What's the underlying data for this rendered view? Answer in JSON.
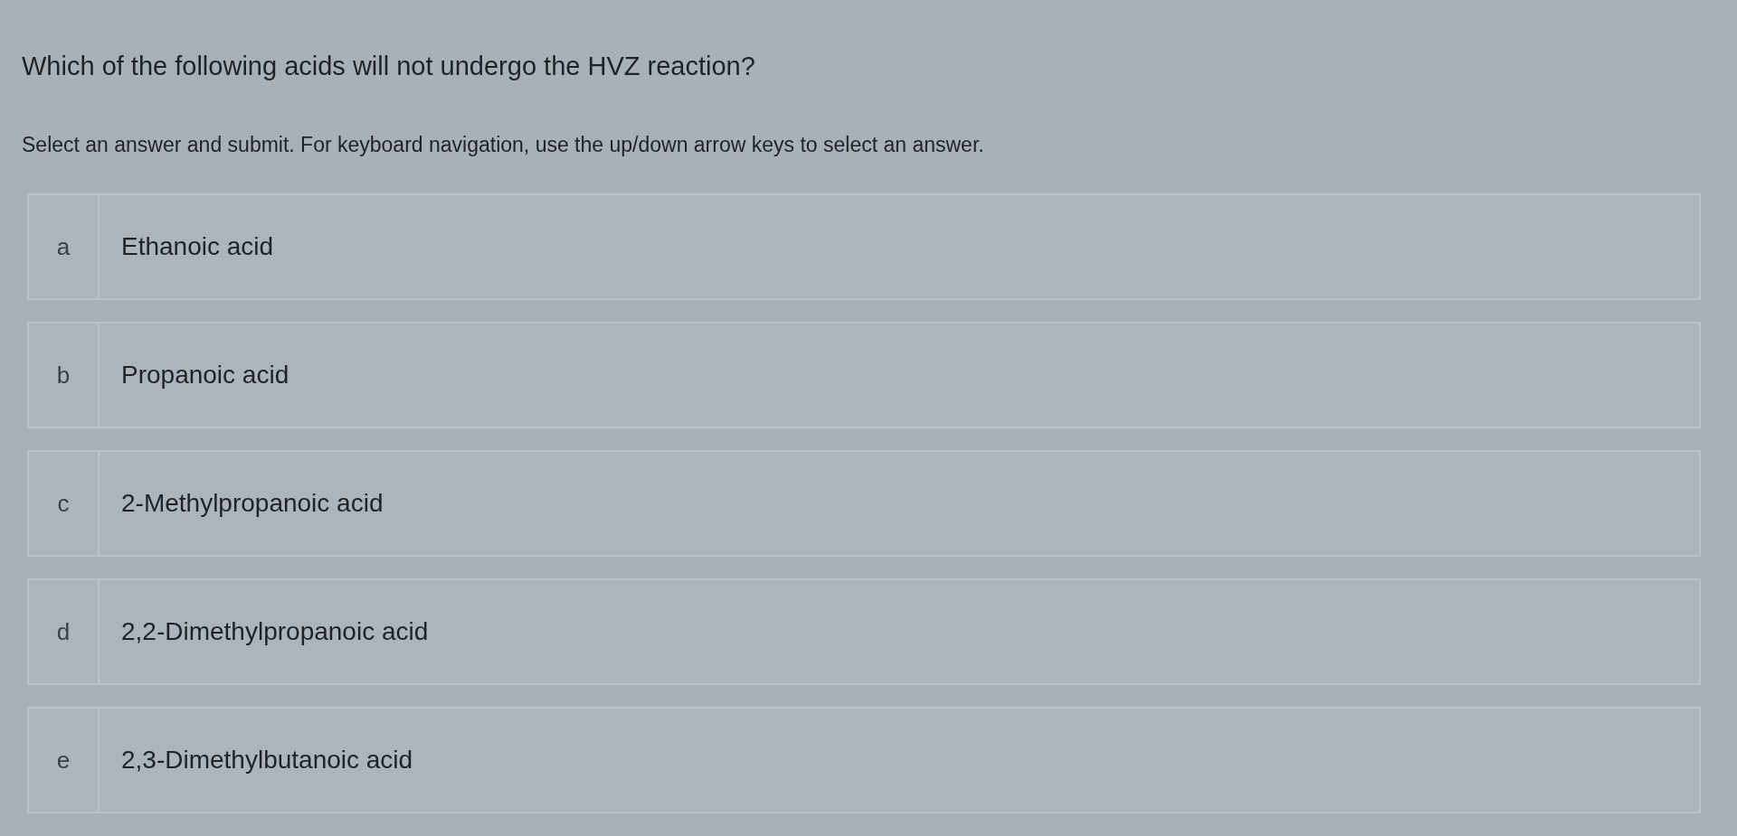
{
  "question": "Which of the following acids will not undergo the HVZ reaction?",
  "instructions": "Select an answer and submit. For keyboard navigation, use the up/down arrow keys to select an answer.",
  "options": [
    {
      "letter": "a",
      "label": "Ethanoic acid",
      "selected": false
    },
    {
      "letter": "b",
      "label": "Propanoic acid",
      "selected": false
    },
    {
      "letter": "c",
      "label": "2-Methylpropanoic acid",
      "selected": false
    },
    {
      "letter": "d",
      "label": "2,2-Dimethylpropanoic acid",
      "selected": false
    },
    {
      "letter": "e",
      "label": "2,3-Dimethylbutanoic acid",
      "selected": false
    }
  ]
}
